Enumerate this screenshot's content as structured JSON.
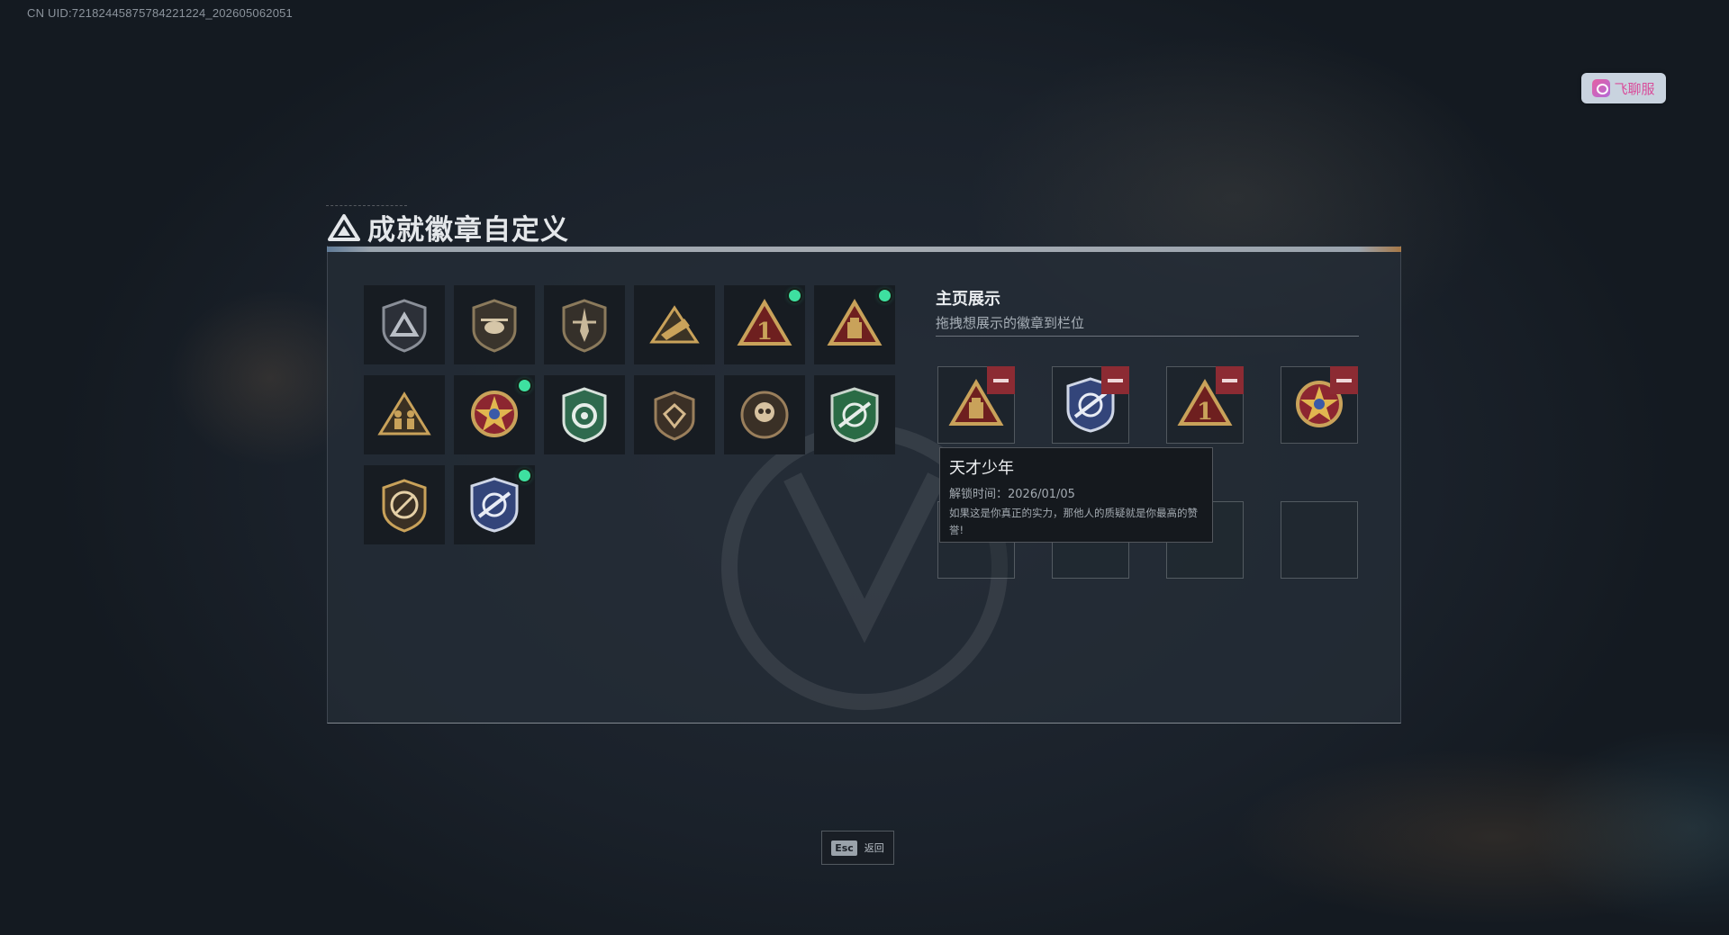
{
  "uid": "CN UID:72182445875784221224_202605062051",
  "chat_button": {
    "label": "飞聊服",
    "icon": "chat-app-icon"
  },
  "title": {
    "text": "成就徽章自定义",
    "icon": "triangle-logo-icon"
  },
  "badges": [
    {
      "icon": "triangle-shield-badge",
      "new": false
    },
    {
      "icon": "helicopter-shield-badge",
      "new": false
    },
    {
      "icon": "dagger-shield-badge",
      "new": false
    },
    {
      "icon": "rocket-launcher-badge",
      "new": false
    },
    {
      "icon": "number-one-triangle-badge",
      "new": true
    },
    {
      "icon": "supply-box-triangle-badge",
      "new": true
    },
    {
      "icon": "soldiers-triangle-badge",
      "new": false
    },
    {
      "icon": "star-medal-badge",
      "new": true
    },
    {
      "icon": "green-scope-shield-badge",
      "new": false
    },
    {
      "icon": "gem-shield-badge",
      "new": false
    },
    {
      "icon": "skull-emblem-badge",
      "new": false
    },
    {
      "icon": "green-sniper-shield-badge",
      "new": false
    },
    {
      "icon": "no-rifle-shield-badge",
      "new": false
    },
    {
      "icon": "blue-sniper-shield-badge",
      "new": true
    }
  ],
  "showcase": {
    "title": "主页展示",
    "subtitle": "拖拽想展示的徽章到栏位",
    "slots": [
      {
        "icon": "supply-box-triangle-badge",
        "filled": true
      },
      {
        "icon": "blue-sniper-shield-badge",
        "filled": true
      },
      {
        "icon": "number-one-triangle-badge",
        "filled": true
      },
      {
        "icon": "star-medal-badge",
        "filled": true
      },
      {
        "icon": "",
        "filled": false
      },
      {
        "icon": "",
        "filled": false
      },
      {
        "icon": "",
        "filled": false
      },
      {
        "icon": "",
        "filled": false
      }
    ]
  },
  "tooltip": {
    "title": "天才少年",
    "unlock_time": "解锁时间：2026/01/05",
    "description": "如果这是你真正的实力，那他人的质疑就是你最高的赞誉!"
  },
  "esc": {
    "key": "Esc",
    "label": "返回"
  },
  "colors": {
    "new_dot": "#3ee0a0",
    "remove_button": "#8c2b33",
    "badge_gold": "#c9a25a"
  }
}
